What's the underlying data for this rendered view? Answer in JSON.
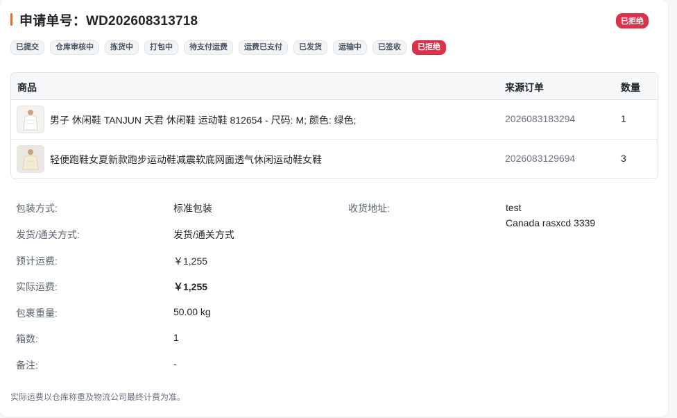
{
  "header": {
    "title": "申请单号：WD202608313718",
    "status": "已拒绝"
  },
  "steps": [
    {
      "label": "已提交",
      "active": false
    },
    {
      "label": "仓库审核中",
      "active": false
    },
    {
      "label": "拣货中",
      "active": false
    },
    {
      "label": "打包中",
      "active": false
    },
    {
      "label": "待支付运费",
      "active": false
    },
    {
      "label": "运费已支付",
      "active": false
    },
    {
      "label": "已发货",
      "active": false
    },
    {
      "label": "运输中",
      "active": false
    },
    {
      "label": "已签收",
      "active": false
    },
    {
      "label": "已拒绝",
      "active": true
    }
  ],
  "table": {
    "headers": {
      "product": "商品",
      "source_order": "来源订单",
      "quantity": "数量"
    },
    "rows": [
      {
        "name": "男子 休闲鞋 TANJUN 天君 休闲鞋 运动鞋 812654 - 尺码: M; 颜色: 绿色;",
        "source_order": "2026083183294",
        "quantity": "1"
      },
      {
        "name": "轻便跑鞋女夏新款跑步运动鞋减震软底网面透气休闲运动鞋女鞋",
        "source_order": "2026083129694",
        "quantity": "3"
      }
    ]
  },
  "details": {
    "packaging_label": "包装方式:",
    "packaging_value": "标准包装",
    "shipping_label": "发货/通关方式:",
    "shipping_value": "发货/通关方式",
    "est_fee_label": "预计运费:",
    "est_fee_value": "￥1,255",
    "actual_fee_label": "实际运费:",
    "actual_fee_value": "￥1,255",
    "weight_label": "包裹重量:",
    "weight_value": "50.00 kg",
    "boxes_label": "箱数:",
    "boxes_value": "1",
    "remark_label": "备注:",
    "remark_value": "-",
    "address_label": "收货地址:",
    "address_line1": "test",
    "address_line2": "Canada rasxcd 3339"
  },
  "footer_note": "实际运费以仓库称重及物流公司最终计费为准。",
  "colors": {
    "accent": "#f06a1a",
    "rejected": "#d9334a"
  }
}
